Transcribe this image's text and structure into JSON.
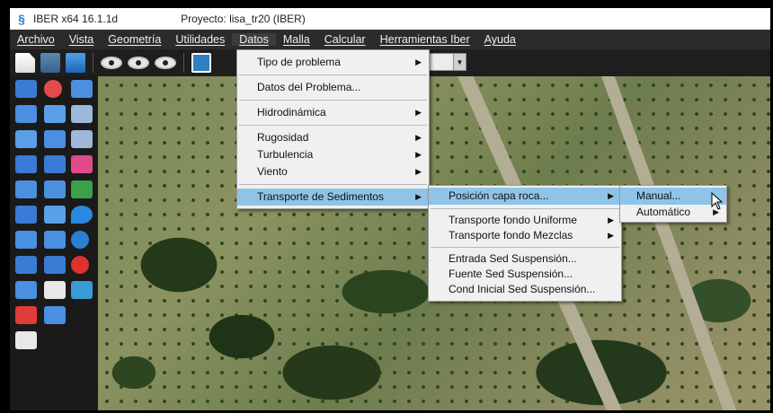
{
  "window": {
    "app_title": "IBER x64 16.1.1d",
    "project_title": "Proyecto: lisa_tr20 (IBER)"
  },
  "menubar": {
    "items": [
      "Archivo",
      "Vista",
      "Geometría",
      "Utilidades",
      "Datos",
      "Malla",
      "Calcular",
      "Herramientas Iber",
      "Ayuda"
    ],
    "active": "Datos"
  },
  "datos_menu": {
    "tipo_problema": "Tipo de problema",
    "datos_problema": "Datos del Problema...",
    "hidrodinamica": "Hidrodinámica",
    "rugosidad": "Rugosidad",
    "turbulencia": "Turbulencia",
    "viento": "Viento",
    "transporte_sedimentos": "Transporte de Sedimentos"
  },
  "sedimentos_menu": {
    "posicion_capa_roca": "Posición capa roca...",
    "fondo_uniforme": "Transporte fondo Uniforme",
    "fondo_mezclas": "Transporte fondo Mezclas",
    "entrada_suspension": "Entrada Sed Suspensión...",
    "fuente_suspension": "Fuente Sed Suspensión...",
    "cond_inicial_suspension": "Cond Inicial Sed Suspensión..."
  },
  "roca_menu": {
    "manual": "Manual...",
    "automatico": "Automático"
  },
  "icons": [
    "new-file-icon",
    "open-folder-icon",
    "save-icon",
    "view-eye-icon",
    "camera-icon",
    "submenu-arrow-icon",
    "cursor-arrow-icon"
  ],
  "colors": {
    "menu_highlight": "#8fc4e8",
    "menubar_bg": "#2b2b2b",
    "menu_bg": "#f0f0f0"
  }
}
